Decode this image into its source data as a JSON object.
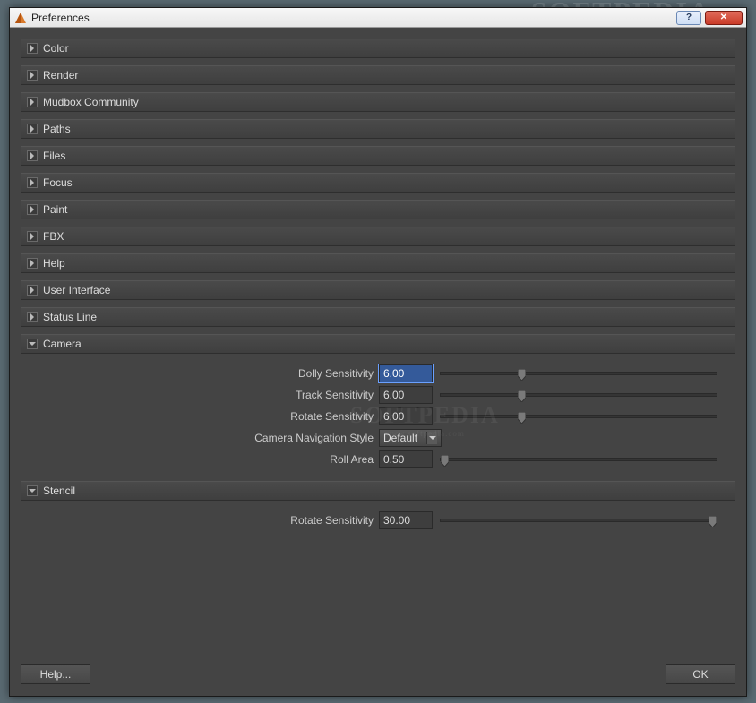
{
  "window": {
    "title": "Preferences",
    "help_glyph": "?",
    "close_glyph": "✕"
  },
  "sections": {
    "color": {
      "label": "Color"
    },
    "render": {
      "label": "Render"
    },
    "mudbox_community": {
      "label": "Mudbox Community"
    },
    "paths": {
      "label": "Paths"
    },
    "files": {
      "label": "Files"
    },
    "focus": {
      "label": "Focus"
    },
    "paint": {
      "label": "Paint"
    },
    "fbx": {
      "label": "FBX"
    },
    "help": {
      "label": "Help"
    },
    "user_interface": {
      "label": "User Interface"
    },
    "status_line": {
      "label": "Status Line"
    },
    "camera": {
      "label": "Camera",
      "dolly_sensitivity_label": "Dolly Sensitivity",
      "dolly_sensitivity_value": "6.00",
      "track_sensitivity_label": "Track Sensitivity",
      "track_sensitivity_value": "6.00",
      "rotate_sensitivity_label": "Rotate Sensitivity",
      "rotate_sensitivity_value": "6.00",
      "nav_style_label": "Camera Navigation Style",
      "nav_style_value": "Default",
      "roll_area_label": "Roll Area",
      "roll_area_value": "0.50"
    },
    "stencil": {
      "label": "Stencil",
      "rotate_sensitivity_label": "Rotate Sensitivity",
      "rotate_sensitivity_value": "30.00"
    }
  },
  "footer": {
    "help_label": "Help...",
    "ok_label": "OK"
  },
  "watermark": {
    "top": "SOFTPEDIA",
    "mid": "SOFTPEDIA",
    "sub": "www.softpedia.com"
  }
}
